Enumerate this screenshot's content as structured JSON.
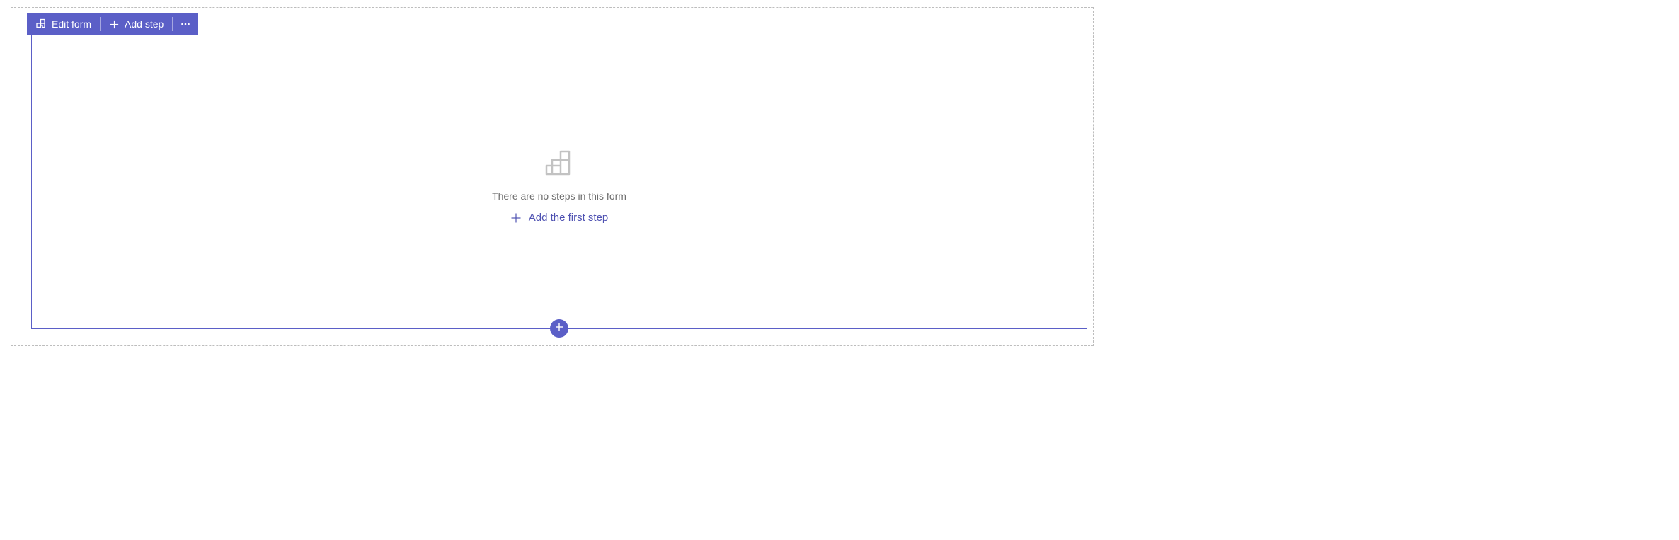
{
  "toolbar": {
    "edit_form_label": "Edit form",
    "add_step_label": "Add step"
  },
  "empty_state": {
    "message": "There are no steps in this form",
    "add_first_label": "Add the first step"
  },
  "colors": {
    "brand": "#5b5fc7",
    "brand_dark": "#4f52b2",
    "dashed_border": "#bdbdbd",
    "muted_text": "#6e6e6e",
    "icon_gray": "#c2c2c2"
  }
}
